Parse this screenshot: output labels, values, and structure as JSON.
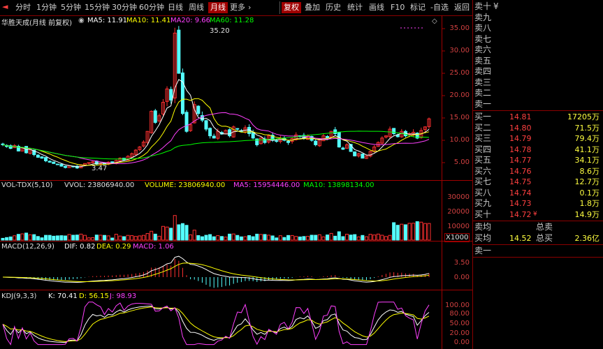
{
  "toolbar": {
    "items": [
      "分时",
      "1分钟",
      "5分钟",
      "15分钟",
      "30分钟",
      "60分钟",
      "日线",
      "周线",
      "月线",
      "更多"
    ],
    "active": "月线",
    "more_arrow": "›",
    "right_items": [
      "复权",
      "叠加",
      "历史",
      "统计",
      "画线",
      "F10",
      "标记",
      "-自选",
      "返回"
    ]
  },
  "stock": {
    "title": "华胜天成(月线 前复权)",
    "ma5": "MA5: 11.91",
    "ma10": "MA10: 11.41",
    "ma20": "MA20: 9.66",
    "ma60": "MA60: 11.28",
    "high_label": "35.20",
    "low_label": "3.47"
  },
  "price_axis": [
    "35.00",
    "30.00",
    "25.00",
    "20.00",
    "15.00",
    "10.00",
    "5.00"
  ],
  "volume": {
    "header": "VOL-TDX(5,10)  VVOL: 23806940.00  VOLUME: 23806940.00  MA5: 15954446.00  MA10: 13898134.00",
    "title": "VOL-TDX(5,10)",
    "vvol": "VVOL: 23806940.00",
    "volume": "VOLUME: 23806940.00",
    "ma5": "MA5: 15954446.00",
    "ma10": "MA10: 13898134.00",
    "axis": [
      "30000",
      "20000",
      "10000"
    ],
    "unit": "X1000"
  },
  "macd": {
    "title": "MACD(12,26,9)",
    "dif": "DIF: 0.82",
    "dea": "DEA: 0.29",
    "macd": "MACD: 1.06",
    "axis": [
      "3.50",
      "0.00"
    ]
  },
  "kdj": {
    "title": "KDJ(9,3,3)",
    "k": "K: 70.41",
    "d": "D: 56.15",
    "j": "J: 98.93",
    "axis": [
      "100.00",
      "80.00",
      "50.00",
      "20.00",
      "0.00"
    ]
  },
  "orderbook": {
    "sell": [
      {
        "label": "卖十",
        "price": "",
        "vol": ""
      },
      {
        "label": "卖九",
        "price": "",
        "vol": ""
      },
      {
        "label": "卖八",
        "price": "",
        "vol": ""
      },
      {
        "label": "卖七",
        "price": "",
        "vol": ""
      },
      {
        "label": "卖六",
        "price": "",
        "vol": ""
      },
      {
        "label": "卖五",
        "price": "",
        "vol": ""
      },
      {
        "label": "卖四",
        "price": "",
        "vol": ""
      },
      {
        "label": "卖三",
        "price": "",
        "vol": ""
      },
      {
        "label": "卖二",
        "price": "",
        "vol": ""
      },
      {
        "label": "卖一",
        "price": "",
        "vol": ""
      }
    ],
    "sell_top_symbol": "¥",
    "buy": [
      {
        "label": "买一",
        "price": "14.81",
        "vol": "17205万"
      },
      {
        "label": "买二",
        "price": "14.80",
        "vol": "71.5万"
      },
      {
        "label": "买三",
        "price": "14.79",
        "vol": "79.4万"
      },
      {
        "label": "买四",
        "price": "14.78",
        "vol": "41.1万"
      },
      {
        "label": "买五",
        "price": "14.77",
        "vol": "34.1万"
      },
      {
        "label": "买六",
        "price": "14.76",
        "vol": "8.6万"
      },
      {
        "label": "买七",
        "price": "14.75",
        "vol": "12.7万"
      },
      {
        "label": "买八",
        "price": "14.74",
        "vol": "0.1万"
      },
      {
        "label": "买九",
        "price": "14.73",
        "vol": "1.8万"
      },
      {
        "label": "买十",
        "price": "14.72",
        "vol": "14.9万"
      }
    ],
    "buy10_mark": "¥",
    "sell_avg_label": "卖均",
    "sell_avg_value": "",
    "total_sell_label": "总卖",
    "total_sell_value": "",
    "buy_avg_label": "买均",
    "buy_avg_value": "14.52",
    "total_buy_label": "总买",
    "total_buy_value": "2.36亿",
    "last_label": "卖一"
  },
  "colors": {
    "up": "#ff3030",
    "down": "#54ffff",
    "ma5": "#ffffff",
    "ma10": "#ffff00",
    "ma20": "#ff40ff",
    "ma60": "#00ff00",
    "frame": "#a00000"
  },
  "chart_data": {
    "type": "line",
    "title": "华胜天成(月线 前复权)",
    "ylim": [
      3,
      36
    ],
    "series": [
      {
        "name": "MA5",
        "values": [
          11.91
        ]
      },
      {
        "name": "MA10",
        "values": [
          11.41
        ]
      },
      {
        "name": "MA20",
        "values": [
          9.66
        ]
      },
      {
        "name": "MA60",
        "values": [
          11.28
        ]
      }
    ],
    "high": 35.2,
    "low": 3.47,
    "closes": [
      9.0,
      8.6,
      8.2,
      8.8,
      7.6,
      8.4,
      7.2,
      7.9,
      6.8,
      6.2,
      6.0,
      5.4,
      5.1,
      4.8,
      4.6,
      4.2,
      3.9,
      4.3,
      4.1,
      3.8,
      4.5,
      4.8,
      5.0,
      5.2,
      4.7,
      4.9,
      4.6,
      5.1,
      5.0,
      5.5,
      6.0,
      5.6,
      6.4,
      7.0,
      7.8,
      8.5,
      9.6,
      12.0,
      16.5,
      14.0,
      15.5,
      18.5,
      21.5,
      19.0,
      34.0,
      25.0,
      16.0,
      12.0,
      13.5,
      18.0,
      16.0,
      14.5,
      12.5,
      11.0,
      10.5,
      12.0,
      11.4,
      12.2,
      11.0,
      13.0,
      12.5,
      12.0,
      12.8,
      11.5,
      10.5,
      9.0,
      10.5,
      9.5,
      11.0,
      10.0,
      9.8,
      10.5,
      10.0,
      9.5,
      10.4,
      11.2,
      10.8,
      10.5,
      11.0,
      10.0,
      9.0,
      10.2,
      11.0,
      10.5,
      12.0,
      11.5,
      8.5,
      8.0,
      9.0,
      7.5,
      6.5,
      7.0,
      6.0,
      6.5,
      7.5,
      8.5,
      9.5,
      10.5,
      11.0,
      12.5,
      11.5,
      10.8,
      12.0,
      11.0,
      11.5,
      11.8,
      10.5,
      12.2,
      13.0,
      14.8
    ],
    "kdj": {
      "k": 70.41,
      "d": 56.15,
      "j": 98.93
    },
    "macd": {
      "dif": 0.82,
      "dea": 0.29,
      "macd": 1.06
    }
  }
}
